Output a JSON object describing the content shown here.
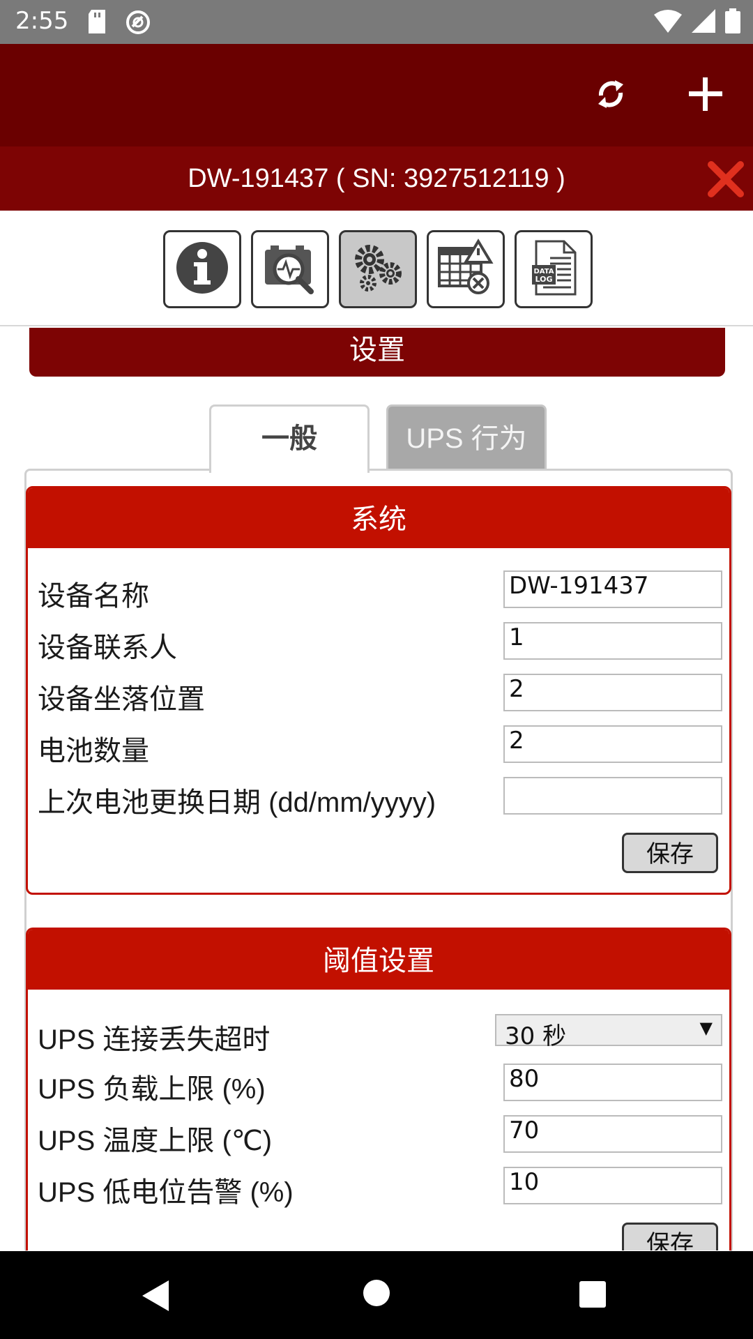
{
  "status_bar": {
    "time": "2:55"
  },
  "device": {
    "title": "DW-191437 ( SN: 3927512119 )"
  },
  "section": {
    "title": "设置"
  },
  "tabs": [
    {
      "label": "一般"
    },
    {
      "label": "UPS 行为"
    }
  ],
  "system": {
    "title": "系统",
    "fields": [
      {
        "label": "设备名称",
        "value": "DW-191437"
      },
      {
        "label": "设备联系人",
        "value": "1"
      },
      {
        "label": "设备坐落位置",
        "value": "2"
      },
      {
        "label": "电池数量",
        "value": "2"
      },
      {
        "label": "上次电池更换日期 (dd/mm/yyyy)",
        "value": ""
      }
    ],
    "save_label": "保存"
  },
  "threshold": {
    "title": "阈值设置",
    "timeout": {
      "label": "UPS 连接丢失超时",
      "value": "30 秒"
    },
    "fields": [
      {
        "label": "UPS 负载上限 (%)",
        "value": "80"
      },
      {
        "label": "UPS 温度上限 (℃)",
        "value": "70"
      },
      {
        "label": "UPS 低电位告警 (%)",
        "value": "10"
      }
    ],
    "save_label": "保存"
  },
  "icons": {
    "toolbar": [
      "info-icon",
      "battery-diagnostic-icon",
      "settings-gears-icon",
      "schedule-alert-icon",
      "data-log-icon"
    ],
    "appbar": [
      "sync-icon",
      "add-icon"
    ],
    "close": "close-icon"
  },
  "colors": {
    "appbar": "#6a0000",
    "devicebar": "#7d0404",
    "card_header": "#c21000",
    "close": "#e0301e"
  }
}
